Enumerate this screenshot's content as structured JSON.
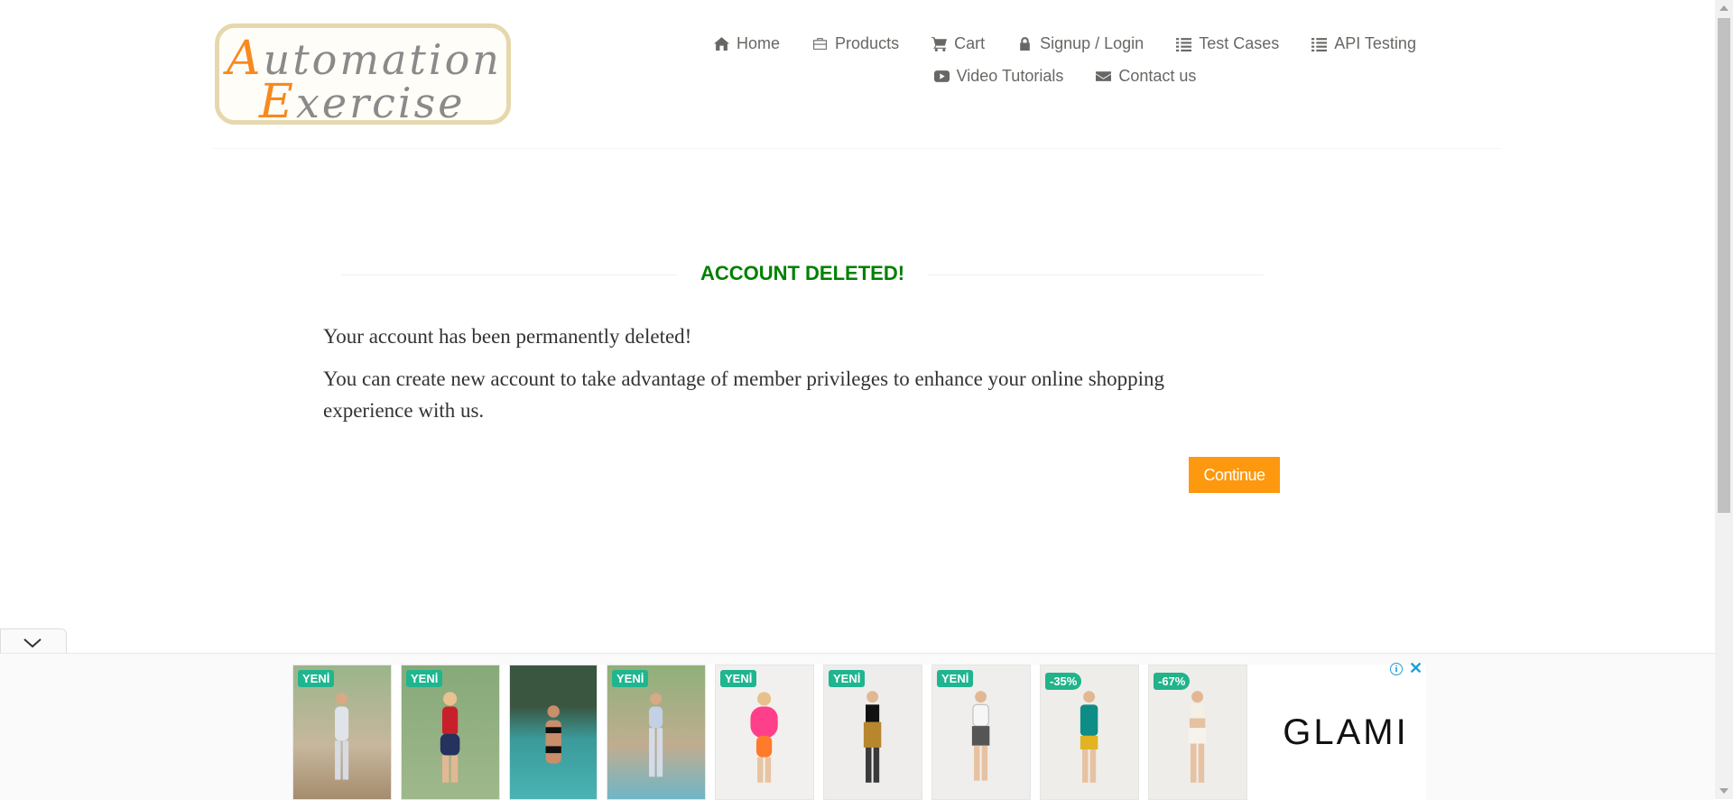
{
  "logo": {
    "line1_cap": "A",
    "line1_rest": "utomation",
    "line2_cap": "E",
    "line2_rest": "xercise"
  },
  "nav": {
    "row1": [
      {
        "label": "Home",
        "icon": "home-icon"
      },
      {
        "label": "Products",
        "icon": "briefcase-icon"
      },
      {
        "label": "Cart",
        "icon": "cart-icon"
      },
      {
        "label": "Signup / Login",
        "icon": "lock-icon"
      },
      {
        "label": "Test Cases",
        "icon": "list-icon"
      },
      {
        "label": "API Testing",
        "icon": "list-icon"
      }
    ],
    "row2": [
      {
        "label": "Video Tutorials",
        "icon": "youtube-play-icon"
      },
      {
        "label": "Contact us",
        "icon": "envelope-icon"
      }
    ]
  },
  "main": {
    "title": "ACCOUNT DELETED!",
    "message1": "Your account has been permanently deleted!",
    "message2": "You can create new account to take advantage of member privileges to enhance your online shopping experience with us.",
    "continue_label": "Continue"
  },
  "ad": {
    "products": [
      {
        "badge": "YENİ",
        "kind": "new"
      },
      {
        "badge": "YENİ",
        "kind": "new"
      },
      {
        "badge": "",
        "kind": "none"
      },
      {
        "badge": "YENİ",
        "kind": "new"
      },
      {
        "badge": "YENİ",
        "kind": "new"
      },
      {
        "badge": "YENİ",
        "kind": "new"
      },
      {
        "badge": "YENİ",
        "kind": "new"
      },
      {
        "badge": "-35%",
        "kind": "discount"
      },
      {
        "badge": "-67%",
        "kind": "discount"
      }
    ],
    "brand": "GLAMI",
    "info_label": "i",
    "close_label": "✕"
  },
  "colors": {
    "accent": "#fe980f",
    "title_green": "#008000",
    "badge_green": "#1fb58f"
  }
}
